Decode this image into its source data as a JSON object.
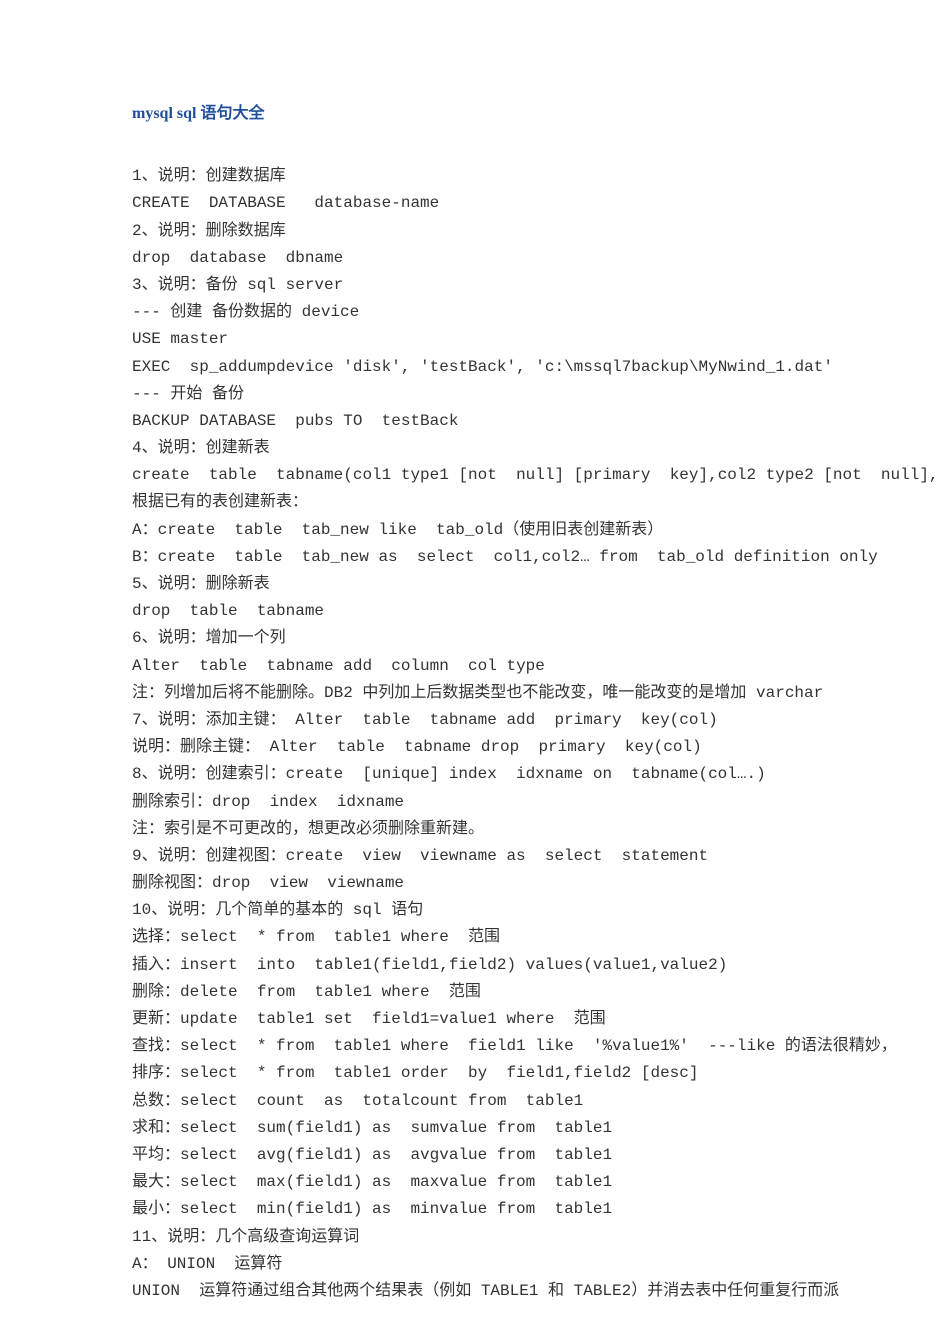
{
  "title": "mysql sql 语句大全",
  "lines": [
    "1、说明：创建数据库",
    "CREATE  DATABASE   database-name",
    "2、说明：删除数据库",
    "drop  database  dbname",
    "3、说明：备份 sql server",
    "--- 创建 备份数据的 device",
    "USE master",
    "EXEC  sp_addumpdevice 'disk', 'testBack', 'c:\\mssql7backup\\MyNwind_1.dat'",
    "--- 开始 备份",
    "BACKUP DATABASE  pubs TO  testBack",
    "4、说明：创建新表",
    "create  table  tabname(col1 type1 [not  null] [primary  key],col2 type2 [not  null],",
    "根据已有的表创建新表：",
    "A：create  table  tab_new like  tab_old（使用旧表创建新表）",
    "B：create  table  tab_new as  select  col1,col2… from  tab_old definition only",
    "5、说明：删除新表",
    "drop  table  tabname",
    "6、说明：增加一个列",
    "Alter  table  tabname add  column  col type",
    "注：列增加后将不能删除。DB2 中列加上后数据类型也不能改变，唯一能改变的是增加 varchar",
    "7、说明：添加主键： Alter  table  tabname add  primary  key(col)",
    "说明：删除主键： Alter  table  tabname drop  primary  key(col)",
    "8、说明：创建索引：create  [unique] index  idxname on  tabname(col….)",
    "删除索引：drop  index  idxname",
    "注：索引是不可更改的，想更改必须删除重新建。",
    "9、说明：创建视图：create  view  viewname as  select  statement",
    "删除视图：drop  view  viewname",
    "10、说明：几个简单的基本的 sql 语句",
    "选择：select  * from  table1 where  范围",
    "插入：insert  into  table1(field1,field2) values(value1,value2)",
    "删除：delete  from  table1 where  范围",
    "更新：update  table1 set  field1=value1 where  范围",
    "查找：select  * from  table1 where  field1 like  '%value1%'  ---like 的语法很精妙，",
    "排序：select  * from  table1 order  by  field1,field2 [desc]",
    "总数：select  count  as  totalcount from  table1",
    "求和：select  sum(field1) as  sumvalue from  table1",
    "平均：select  avg(field1) as  avgvalue from  table1",
    "最大：select  max(field1) as  maxvalue from  table1",
    "最小：select  min(field1) as  minvalue from  table1",
    "11、说明：几个高级查询运算词",
    "A： UNION  运算符",
    "UNION  运算符通过组合其他两个结果表（例如 TABLE1 和 TABLE2）并消去表中任何重复行而派"
  ]
}
